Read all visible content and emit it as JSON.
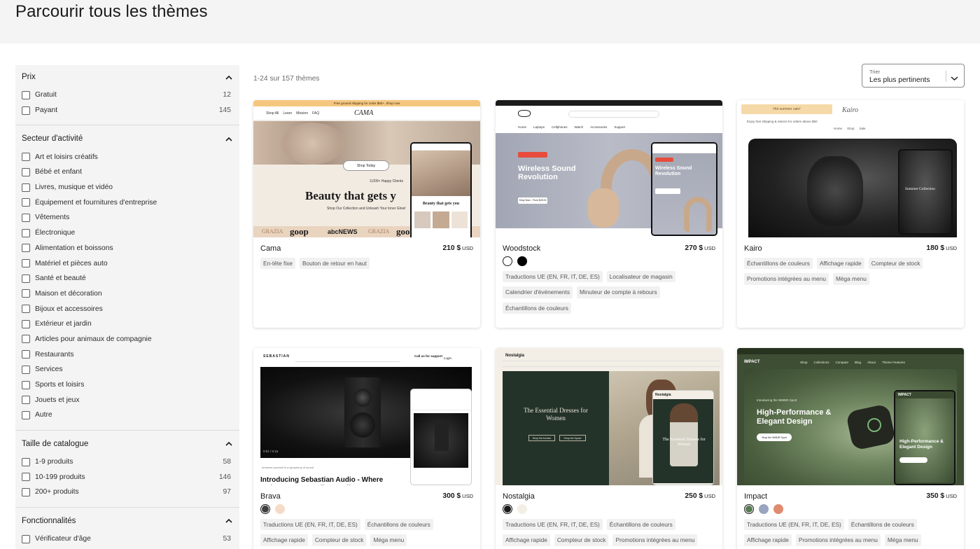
{
  "page": {
    "title": "Parcourir tous les thèmes"
  },
  "sidebar": {
    "sections": [
      {
        "title": "Prix",
        "options": [
          {
            "label": "Gratuit",
            "count": "12"
          },
          {
            "label": "Payant",
            "count": "145"
          }
        ]
      },
      {
        "title": "Secteur d'activité",
        "options": [
          {
            "label": "Art et loisirs créatifs"
          },
          {
            "label": "Bébé et enfant"
          },
          {
            "label": "Livres, musique et vidéo"
          },
          {
            "label": "Équipement et fournitures d'entreprise"
          },
          {
            "label": "Vêtements"
          },
          {
            "label": "Électronique"
          },
          {
            "label": "Alimentation et boissons"
          },
          {
            "label": "Matériel et pièces auto"
          },
          {
            "label": "Santé et beauté"
          },
          {
            "label": "Maison et décoration"
          },
          {
            "label": "Bijoux et accessoires"
          },
          {
            "label": "Extérieur et jardin"
          },
          {
            "label": "Articles pour animaux de compagnie"
          },
          {
            "label": "Restaurants"
          },
          {
            "label": "Services"
          },
          {
            "label": "Sports et loisirs"
          },
          {
            "label": "Jouets et jeux"
          },
          {
            "label": "Autre"
          }
        ]
      },
      {
        "title": "Taille de catalogue",
        "options": [
          {
            "label": "1-9 produits",
            "count": "58"
          },
          {
            "label": "10-199 produits",
            "count": "146"
          },
          {
            "label": "200+ produits",
            "count": "97"
          }
        ]
      },
      {
        "title": "Fonctionnalités",
        "options": [
          {
            "label": "Vérificateur d'âge",
            "count": "53"
          }
        ]
      }
    ]
  },
  "results": {
    "count_text": "1-24 sur 157 thèmes"
  },
  "sort": {
    "label": "Trier",
    "value": "Les plus pertinents"
  },
  "themes": [
    {
      "name": "Cama",
      "price": "210 $",
      "currency": "USD",
      "swatches": [],
      "tags": [
        "En-tête fixe",
        "Bouton de retour en haut"
      ],
      "preview": {
        "banner": "Free ground shipping for order $60+. Shop now",
        "nav": [
          "Shop All",
          "Learn",
          "Mission",
          "FAQ"
        ],
        "logo": "CAMA",
        "button": "Shop Today",
        "reviews": "3,000+ Happy Clients",
        "headline": "Beauty that gets y",
        "sub": "Shop Our Collection and Unleash Your Inner Glow!",
        "press": [
          "GRAZIA",
          "goop",
          "abcNEWS",
          "GRAZIA",
          "goo"
        ],
        "mobile_headline": "Beauty that gets you"
      }
    },
    {
      "name": "Woodstock",
      "price": "270 $",
      "currency": "USD",
      "swatches": [
        "#ffffff",
        "#000000"
      ],
      "tags": [
        "Traductions UE (EN, FR, IT, DE, ES)",
        "Localisateur de magasin",
        "Calendrier d'événements",
        "Minuteur de compte à rebours",
        "Échantillons de couleurs"
      ],
      "preview": {
        "headline": "Wireless Sound Revolution",
        "cta": "Shop Now - From $49.00",
        "nav": [
          "Home",
          "Laptops",
          "Cellphones",
          "Watch",
          "Accessories",
          "Support"
        ]
      }
    },
    {
      "name": "Kairo",
      "price": "180 $",
      "currency": "USD",
      "swatches": [],
      "tags": [
        "Échantillons de couleurs",
        "Affichage rapide",
        "Compteur de stock",
        "Promotions intégrées au menu",
        "Méga menu"
      ],
      "preview": {
        "popup": "Hot summer sale!",
        "logo": "Kairo",
        "shipping": "Enjoy free shipping & returns for orders above $50",
        "nav": [
          "Home",
          "Shop",
          "Sale"
        ],
        "mobile_text": "Summer Collection"
      }
    },
    {
      "name": "Brava",
      "price": "300 $",
      "currency": "USD",
      "swatches": [
        "#3f3f3f",
        "#f5dcc8"
      ],
      "tags": [
        "Traductions UE (EN, FR, IT, DE, ES)",
        "Échantillons de couleurs",
        "Affichage rapide",
        "Compteur de stock",
        "Méga menu"
      ],
      "preview": {
        "logo": "SEBASTIAN",
        "support": "Call us for support",
        "login": "Login",
        "caption": "Immerse yourself in a symphony of sound",
        "headline": "Introducing Sebastian Audio - Where Artistry Meets Audio Excellence",
        "time": "0:01 / 0:15"
      }
    },
    {
      "name": "Nostalgia",
      "price": "250 $",
      "currency": "USD",
      "swatches": [
        "#1a1a1a",
        "#f3efe6"
      ],
      "tags": [
        "Traductions UE (EN, FR, IT, DE, ES)",
        "Échantillons de couleurs",
        "Affichage rapide",
        "Compteur de stock",
        "Promotions intégrées au menu"
      ],
      "preview": {
        "logo": "Nostalgia",
        "headline": "The Essential Dresses for Women",
        "btn1": "Shop the Archive",
        "btn2": "Shop the Space",
        "mobile_headline": "The Essential Dresses for Women"
      }
    },
    {
      "name": "Impact",
      "price": "350 $",
      "currency": "USD",
      "swatches": [
        "#5a7a55",
        "#9aa4c0",
        "#e08a6e"
      ],
      "tags": [
        "Traductions UE (EN, FR, IT, DE, ES)",
        "Échantillons de couleurs",
        "Affichage rapide",
        "Promotions intégrées au menu",
        "Méga menu"
      ],
      "preview": {
        "logo": "IMPACT",
        "headline": "High-Performance & Elegant Design",
        "intro": "Introducing the WMNR Sport",
        "cta": "Shop the WMNR Sport",
        "nav": [
          "Shop",
          "Collections",
          "Compare",
          "Blog",
          "About",
          "Theme Features"
        ]
      }
    }
  ]
}
